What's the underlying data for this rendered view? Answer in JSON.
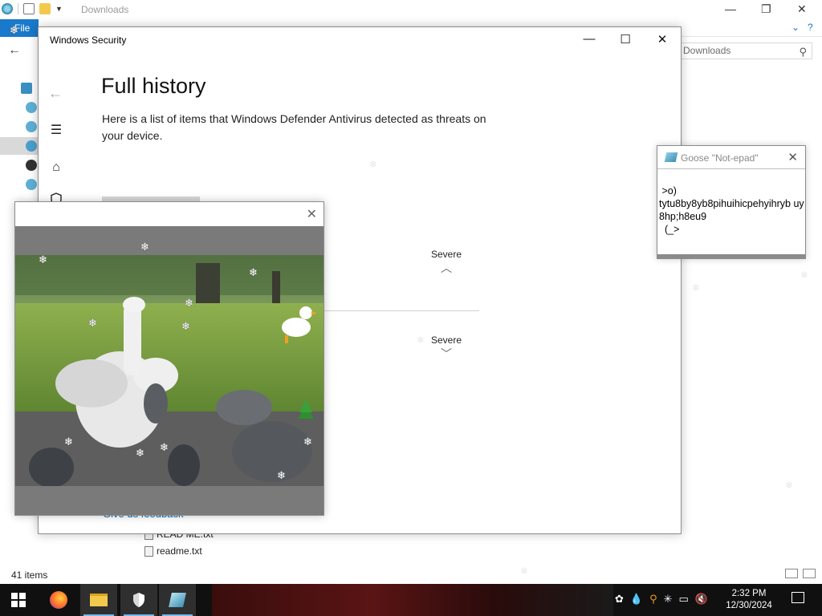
{
  "explorer": {
    "title": "Downloads",
    "file_tab": "File",
    "search_placeholder": "h Downloads",
    "files": [
      "READ ME.txt",
      "readme.txt"
    ],
    "status": "41 items",
    "icons": [
      "window-restore-icon",
      "checkbox-icon",
      "folder-icon",
      "dropdown-icon"
    ]
  },
  "security": {
    "window_title": "Windows Security",
    "page_title": "Full history",
    "description": "Here is a list of items that Windows Defender Antivirus detected as threats on your device.",
    "severity_1": "Severe",
    "severity_2": "Severe",
    "feedback_link": "Give us feedback",
    "rail_icons": [
      "back-arrow-icon",
      "hamburger-menu-icon",
      "home-icon",
      "shield-icon"
    ]
  },
  "notepad": {
    "title": "Goose \"Not-epad\"",
    "body": " >o)\ntytu8by8yb8pihuihicpehyihryb uy8hp;h8eu9\n  (_>"
  },
  "taskbar": {
    "time": "2:32 PM",
    "date": "12/30/2024",
    "apps": [
      "start-icon",
      "firefox-icon",
      "file-explorer-icon",
      "windows-security-icon",
      "notepad-icon"
    ]
  },
  "colors": {
    "accent": "#1979ca",
    "link": "#0067b8",
    "taskbar": "#101010"
  }
}
